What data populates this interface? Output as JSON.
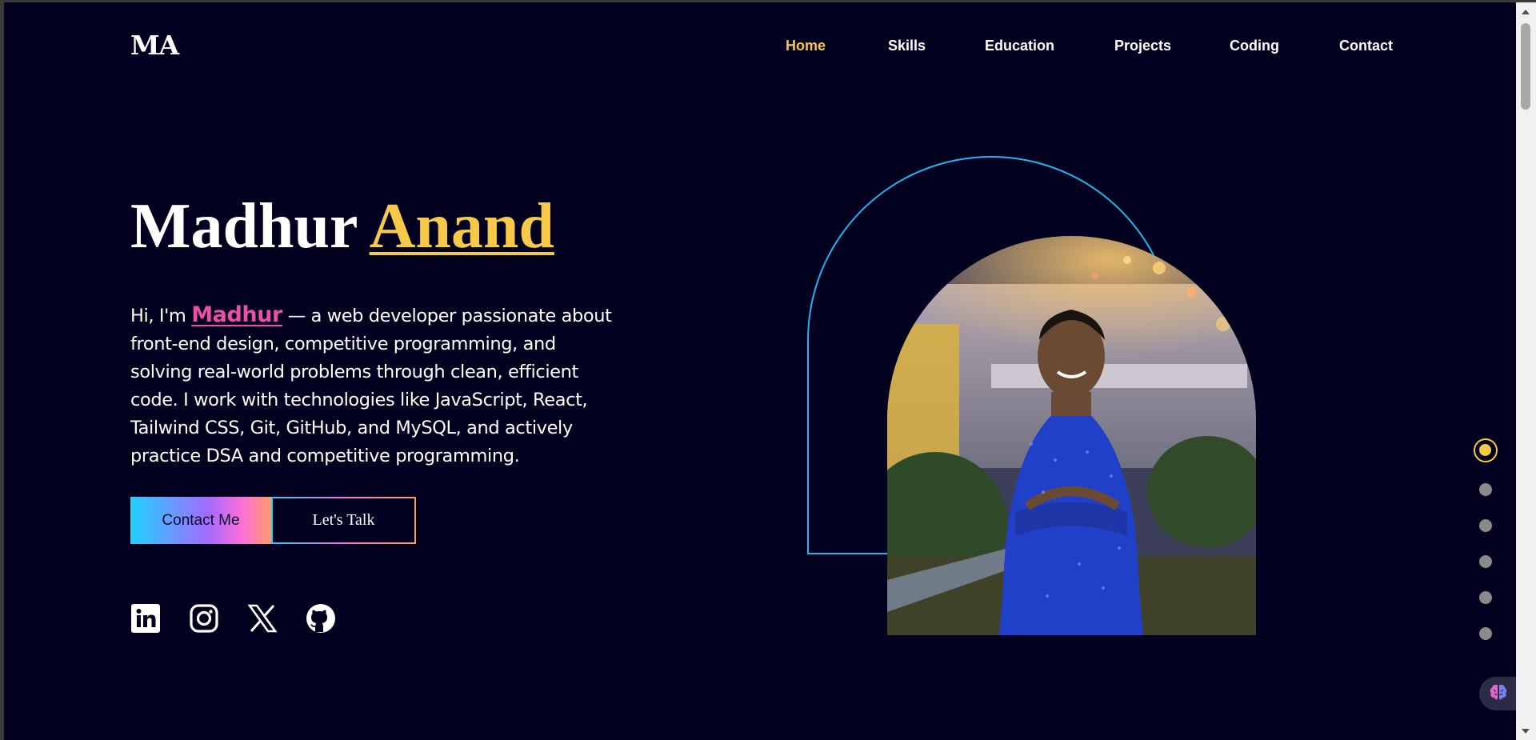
{
  "header": {
    "logo": "MA",
    "nav": [
      {
        "label": "Home",
        "active": true
      },
      {
        "label": "Skills",
        "active": false
      },
      {
        "label": "Education",
        "active": false
      },
      {
        "label": "Projects",
        "active": false
      },
      {
        "label": "Coding",
        "active": false
      },
      {
        "label": "Contact",
        "active": false
      }
    ]
  },
  "hero": {
    "first_name": "Madhur",
    "last_name": "Anand",
    "intro_prefix": "Hi, I'm",
    "intro_name": "Madhur",
    "intro_rest": " — a web developer passionate about front-end design, competitive programming, and solving real-world problems through clean, efficient code. I work with technologies like JavaScript, React, Tailwind CSS, Git, GitHub, and MySQL, and actively practice DSA and competitive programming.",
    "contact_button": "Contact Me",
    "talk_button": "Let's Talk"
  },
  "social": [
    {
      "name": "linkedin-icon"
    },
    {
      "name": "instagram-icon"
    },
    {
      "name": "x-icon"
    },
    {
      "name": "github-icon"
    }
  ],
  "side_nav": {
    "count": 6,
    "active_index": 0
  },
  "colors": {
    "background": "#01001f",
    "accent": "#f7c948",
    "highlight": "#ec4fa8",
    "arch": "#1fb6f0"
  }
}
